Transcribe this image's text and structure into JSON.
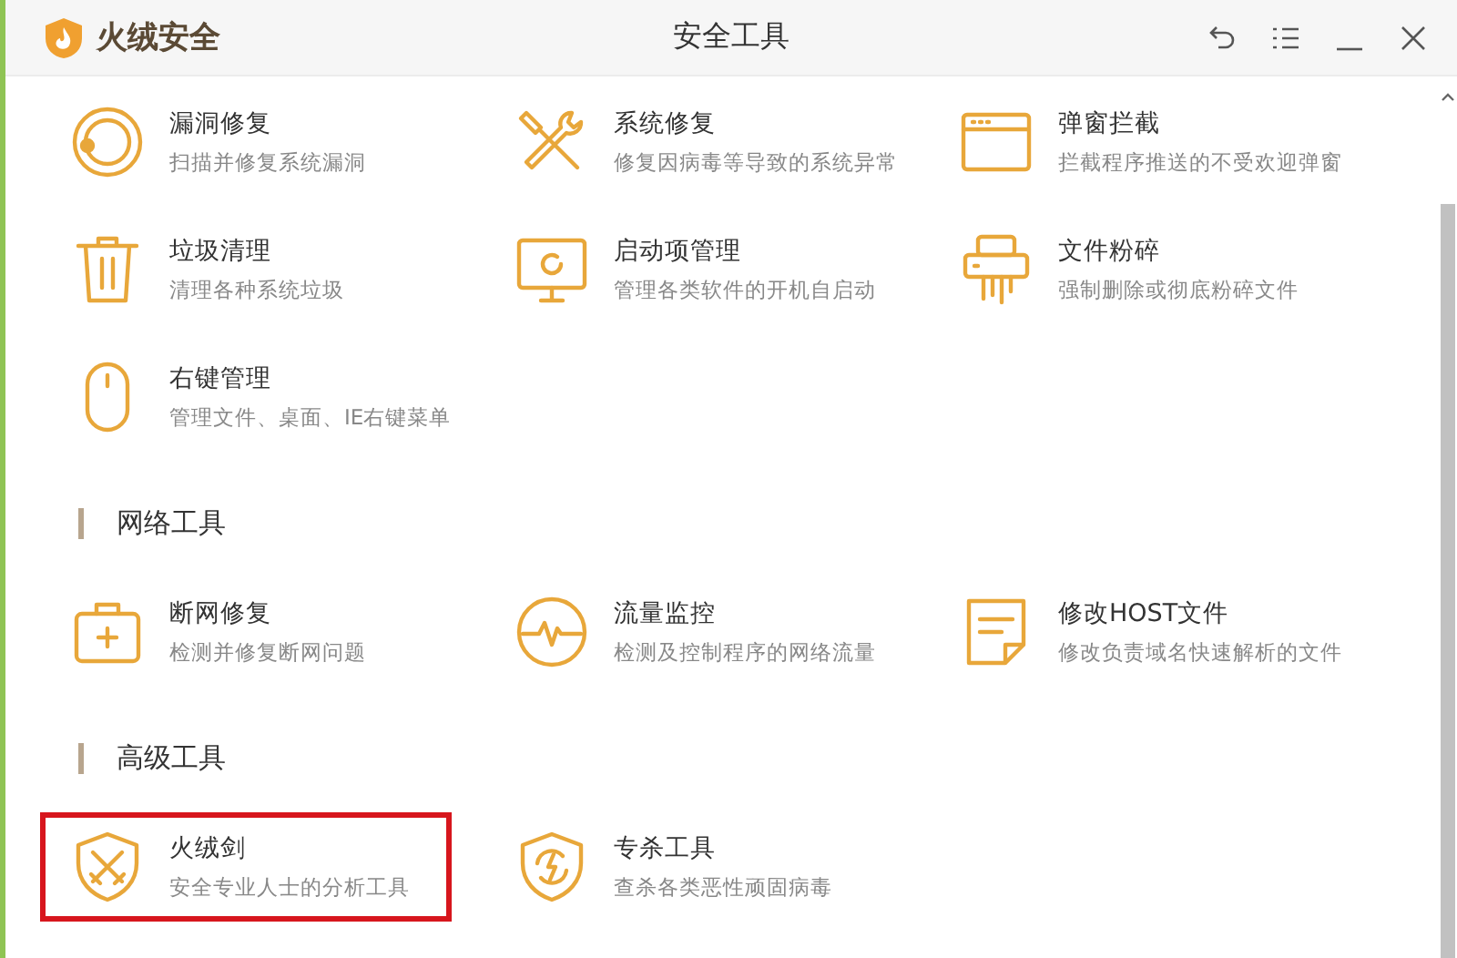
{
  "app": {
    "name": "火绒安全"
  },
  "window": {
    "title": "安全工具"
  },
  "sections": [
    {
      "tools": [
        {
          "kind": "patch",
          "name": "漏洞修复",
          "description": "扫描并修复系统漏洞",
          "highlighted": false
        },
        {
          "kind": "repair",
          "name": "系统修复",
          "description": "修复因病毒等导致的系统异常",
          "highlighted": false
        },
        {
          "kind": "popup",
          "name": "弹窗拦截",
          "description": "拦截程序推送的不受欢迎弹窗",
          "highlighted": false
        },
        {
          "kind": "trash",
          "name": "垃圾清理",
          "description": "清理各种系统垃圾",
          "highlighted": false
        },
        {
          "kind": "startup",
          "name": "启动项管理",
          "description": "管理各类软件的开机自启动",
          "highlighted": false
        },
        {
          "kind": "shredder",
          "name": "文件粉碎",
          "description": "强制删除或彻底粉碎文件",
          "highlighted": false
        },
        {
          "kind": "mouse",
          "name": "右键管理",
          "description": "管理文件、桌面、IE右键菜单",
          "highlighted": false
        }
      ]
    },
    {
      "title": "网络工具",
      "tools": [
        {
          "kind": "firstaid",
          "name": "断网修复",
          "description": "检测并修复断网问题",
          "highlighted": false
        },
        {
          "kind": "traffic",
          "name": "流量监控",
          "description": "检测及控制程序的网络流量",
          "highlighted": false
        },
        {
          "kind": "note",
          "name": "修改HOST文件",
          "description": "修改负责域名快速解析的文件",
          "highlighted": false
        }
      ]
    },
    {
      "title": "高级工具",
      "tools": [
        {
          "kind": "sword",
          "name": "火绒剑",
          "description": "安全专业人士的分析工具",
          "highlighted": true
        },
        {
          "kind": "shield",
          "name": "专杀工具",
          "description": "查杀各类恶性顽固病毒",
          "highlighted": false
        }
      ]
    }
  ]
}
